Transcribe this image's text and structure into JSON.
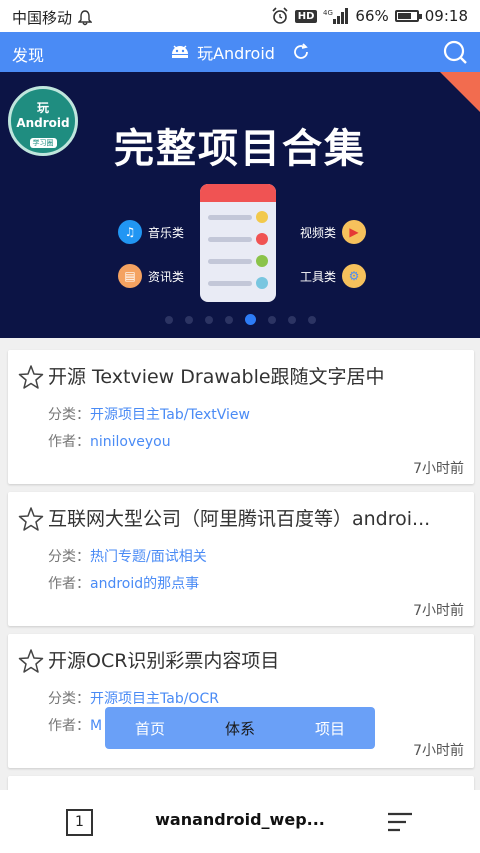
{
  "status": {
    "carrier": "中国移动",
    "battery": "66%",
    "time": "09:18",
    "signal": "4G"
  },
  "appbar": {
    "discover": "发现",
    "title": "玩Android"
  },
  "banner": {
    "badge_top": "玩",
    "badge_main": "Android",
    "badge_sub": "学习圈",
    "title": "完整项目合集",
    "features": [
      "音乐类",
      "视频类",
      "资讯类",
      "工具类"
    ],
    "slide_index": 4,
    "slide_count": 8
  },
  "items": [
    {
      "title": "开源 Textview Drawable跟随文字居中",
      "category_label": "分类：",
      "cat1": "开源项目主Tab",
      "sep": "/",
      "cat2": "TextView",
      "author_label": "作者：",
      "author": "niniloveyou",
      "time": "7小时前"
    },
    {
      "title": "互联网大型公司（阿里腾讯百度等）androi...",
      "category_label": "分类：",
      "cat1": "热门专题",
      "sep": "/",
      "cat2": "面试相关",
      "author_label": "作者：",
      "author": "android的那点事",
      "time": "7小时前"
    },
    {
      "title": "开源OCR识别彩票内容项目",
      "category_label": "分类：",
      "cat1": "开源项目主Tab",
      "sep": "/",
      "cat2": "OCR",
      "author_label": "作者：",
      "author": "M",
      "time": "7小时前"
    }
  ],
  "tabs": [
    "首页",
    "体系",
    "项目"
  ],
  "browser": {
    "tab_count": "1",
    "url": "wanandroid_wep..."
  }
}
